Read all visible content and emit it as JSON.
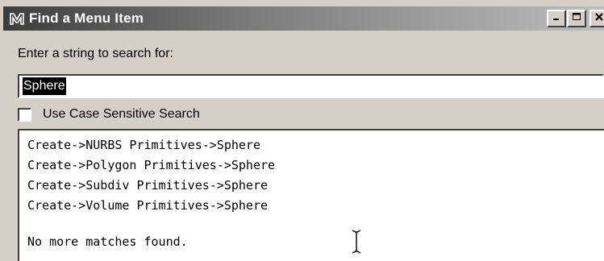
{
  "window": {
    "title": "Find a Menu Item",
    "app_icon": "maya-m-icon",
    "controls": [
      "minimize-icon",
      "maximize-icon",
      "close-icon"
    ]
  },
  "search": {
    "prompt": "Enter a string to search for:",
    "value": "Sphere"
  },
  "options": {
    "case_sensitive_label": "Use Case Sensitive Search",
    "case_sensitive_checked": false
  },
  "results": {
    "items": [
      "Create->NURBS Primitives->Sphere",
      "Create->Polygon Primitives->Sphere",
      "Create->Subdiv Primitives->Sphere",
      "Create->Volume Primitives->Sphere"
    ],
    "status": "No more matches found."
  },
  "colors": {
    "window_bg": "#d4d0c8",
    "title_text": "#ffffff",
    "selection_bg": "#000000"
  }
}
